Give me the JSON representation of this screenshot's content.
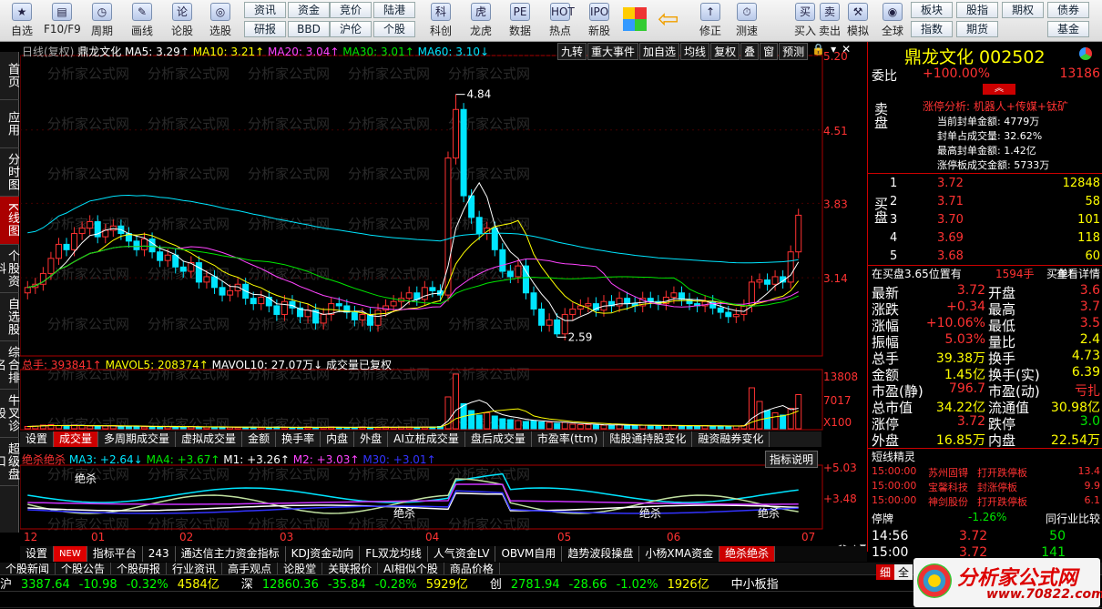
{
  "toolbar": {
    "big": [
      "自选",
      "F10/F9",
      "周期",
      "画线",
      "论股",
      "选股",
      "科创",
      "龙虎",
      "数据",
      "热点",
      "新股",
      "修正",
      "测速",
      "买入",
      "卖出",
      "模拟",
      "全球"
    ],
    "small_top": [
      "资讯",
      "资金",
      "竞价",
      "陆港",
      "板块",
      "股指",
      "期权",
      "债券"
    ],
    "small_bot": [
      "研报",
      "BBD",
      "沪伦",
      "个股",
      "指数",
      "期货",
      "基金"
    ]
  },
  "side_tabs": [
    "首页",
    "应用",
    "分时图",
    "K线图",
    "个股资料",
    "自选股",
    "综合排名",
    "牛叉诊股",
    "超级盘口"
  ],
  "chart_header": {
    "label": "日线(复权)",
    "name": "鼎龙文化",
    "ma5": "MA5: 3.29↑",
    "ma10": "MA10: 3.21↑",
    "ma20": "MA20: 3.04↑",
    "ma30": "MA30: 3.01↑",
    "ma60": "MA60: 3.10↓"
  },
  "chart_tools": [
    "九转",
    "重大事件",
    "加自选",
    "均线",
    "复权",
    "叠",
    "窗",
    "预测"
  ],
  "price_axis": [
    "5.20",
    "4.51",
    "3.83",
    "3.14"
  ],
  "annotations": {
    "high": "4.84",
    "low": "2.59"
  },
  "volume_header": {
    "total": "总手: 393841↑",
    "mavol5": "MAVOL5: 208374↑",
    "mavol10": "MAVOL10: 27.07万↓",
    "note": "成交量已复权"
  },
  "volume_axis": [
    "13808",
    "7017",
    "X100"
  ],
  "indicator_tabs": [
    "设置",
    "成交量",
    "多周期成交量",
    "虚拟成交量",
    "金额",
    "换手率",
    "内盘",
    "外盘",
    "AI立桩成交量",
    "盘后成交量",
    "市盈率(ttm)",
    "陆股通持股变化",
    "融资融券变化"
  ],
  "indicator_header": {
    "name": "绝杀绝杀",
    "ma3": "MA3: +2.64↓",
    "ma4": "MA4: +3.67↑",
    "m1": "M1: +3.26↑",
    "m2": "M2: +3.03↑",
    "m30": "M30: +3.01↑",
    "help": "指标说明"
  },
  "indicator_axis": [
    "+5.03",
    "+3.48"
  ],
  "indicator_labels": [
    "绝杀",
    "绝杀",
    "绝杀",
    "绝杀"
  ],
  "months": [
    "12",
    "01",
    "02",
    "03",
    "04",
    "05",
    "06",
    "07"
  ],
  "bottom_tabs": [
    "设置",
    "NEW",
    "指标平台",
    "243",
    "通达信主力资金指标",
    "KDJ资金动向",
    "FL双龙均线",
    "人气资金LV",
    "OBVM自用",
    "趋势波段操盘",
    "小杨XMA资金",
    "绝杀绝杀"
  ],
  "news_tabs": [
    "个股新闻",
    "个股公告",
    "个股研报",
    "行业资讯",
    "高手观点",
    "论股堂",
    "关联报价",
    "AI相似个股",
    "商品价格"
  ],
  "watermark": "分析家公式网",
  "quote": {
    "title": "鼎龙文化 002502",
    "weibi_label": "委比",
    "weibi": "+100.00%",
    "weicha": "13186",
    "zt_title": "涨停分析: 机器人+传媒+钛矿",
    "zt_lines": [
      "当前封单金额: 4779万",
      "封单占成交量: 32.62%",
      "最高封单金额: 1.42亿",
      "涨停板成交金额: 5733万"
    ],
    "sell_label": "卖盘",
    "buy_label": "买盘",
    "buy": [
      [
        "1",
        "3.72",
        "12848"
      ],
      [
        "2",
        "3.71",
        "58"
      ],
      [
        "3",
        "3.70",
        "101"
      ],
      [
        "4",
        "3.69",
        "118"
      ],
      [
        "5",
        "3.68",
        "60"
      ]
    ],
    "queue": "在买盘3.65位置有",
    "queue_vol": "1594手",
    "queue_tag": "买单!",
    "queue_link": "查看详情",
    "stats": [
      [
        "最新",
        "3.72",
        "开盘",
        "3.6"
      ],
      [
        "涨跌",
        "+0.34",
        "最高",
        "3.7"
      ],
      [
        "涨幅",
        "+10.06%",
        "最低",
        "3.5"
      ],
      [
        "振幅",
        "5.03%",
        "量比",
        "2.4"
      ],
      [
        "总手",
        "39.38万",
        "换手",
        "4.73"
      ],
      [
        "金额",
        "1.45亿",
        "换手(实)",
        "6.39"
      ],
      [
        "市盈(静)",
        "796.7",
        "市盈(动)",
        "亏扎"
      ],
      [
        "总市值",
        "34.22亿",
        "流通值",
        "30.98亿"
      ],
      [
        "涨停",
        "3.72",
        "跌停",
        "3.0"
      ],
      [
        "外盘",
        "16.85万",
        "内盘",
        "22.54万"
      ]
    ],
    "jingling": "短线精灵",
    "spirit": [
      [
        "15:00:00",
        "苏州固锝",
        "打开跌停板",
        "13.4"
      ],
      [
        "15:00:00",
        "宝馨科技",
        "封涨停板",
        "9.9"
      ],
      [
        "15:00:00",
        "神剑股份",
        "打开跌停板",
        "6.1"
      ]
    ],
    "drop_label": "停牌",
    "drop_pct": "-1.26%",
    "tick_btn": "同行业比较",
    "ticks": [
      [
        "14:56",
        "3.72",
        "50"
      ],
      [
        "15:00",
        "3.72",
        "141"
      ]
    ]
  },
  "index_bar": {
    "sh": [
      "沪",
      "3387.64",
      "-10.98",
      "-0.32%",
      "4584亿"
    ],
    "sz": [
      "深",
      "12860.36",
      "-35.84",
      "-0.28%",
      "5929亿"
    ],
    "cy": [
      "创",
      "2781.94",
      "-28.66",
      "-1.02%",
      "1926亿"
    ],
    "zx": "中小板指"
  },
  "logo": {
    "text": "分析家公式网",
    "url": "www.70822.com"
  },
  "bottom_right": [
    "细",
    "全"
  ],
  "chart_data": {
    "type": "candlestick",
    "title": "鼎龙文化 日线(复权)",
    "x_months": [
      "12",
      "01",
      "02",
      "03",
      "04",
      "05",
      "06",
      "07"
    ],
    "ylim": [
      2.5,
      5.2
    ],
    "high": 4.84,
    "low": 2.59,
    "last_close": 3.72,
    "closes": [
      3.05,
      3.08,
      3.18,
      3.32,
      3.45,
      3.4,
      3.55,
      3.6,
      3.66,
      3.52,
      3.58,
      3.62,
      3.55,
      3.48,
      3.4,
      3.5,
      3.38,
      3.3,
      3.35,
      3.24,
      3.2,
      3.28,
      3.1,
      3.15,
      3.05,
      2.98,
      3.02,
      3.08,
      2.95,
      2.9,
      2.96,
      2.88,
      2.8,
      2.92,
      2.86,
      2.78,
      2.84,
      2.72,
      2.8,
      2.9,
      2.88,
      2.82,
      2.75,
      2.8,
      2.7,
      2.84,
      2.88,
      2.92,
      2.95,
      3.0,
      2.94,
      3.05,
      3.02,
      2.98,
      4.25,
      4.7,
      3.9,
      3.7,
      3.55,
      3.6,
      3.4,
      3.2,
      3.15,
      3.25,
      3.0,
      2.85,
      2.7,
      2.75,
      2.62,
      2.8,
      2.85,
      2.88,
      2.9,
      2.84,
      2.92,
      2.88,
      2.95,
      2.9,
      2.88,
      2.95,
      2.92,
      2.9,
      2.96,
      3.0,
      2.94,
      2.9,
      2.88,
      2.92,
      2.86,
      2.82,
      2.78,
      2.8,
      2.88,
      3.1,
      3.12,
      3.08,
      3.15,
      3.1,
      3.38,
      3.72
    ],
    "volume": [
      5,
      6,
      8,
      9,
      7,
      6,
      8,
      7,
      6,
      5,
      6,
      7,
      5,
      6,
      5,
      4,
      5,
      4,
      5,
      4,
      4,
      5,
      3,
      4,
      4,
      3,
      4,
      3,
      3,
      4,
      3,
      3,
      4,
      3,
      3,
      3,
      4,
      3,
      3,
      4,
      3,
      3,
      3,
      4,
      3,
      3,
      4,
      3,
      4,
      4,
      3,
      4,
      4,
      5,
      70,
      120,
      55,
      40,
      30,
      35,
      28,
      22,
      20,
      18,
      16,
      18,
      15,
      14,
      12,
      14,
      10,
      9,
      9,
      8,
      8,
      8,
      9,
      7,
      7,
      8,
      7,
      6,
      7,
      7,
      6,
      6,
      6,
      7,
      6,
      6,
      5,
      6,
      7,
      90,
      60,
      40,
      35,
      30,
      45,
      75
    ],
    "ma_series": [
      "MA5",
      "MA10",
      "MA20",
      "MA30",
      "MA60"
    ]
  }
}
